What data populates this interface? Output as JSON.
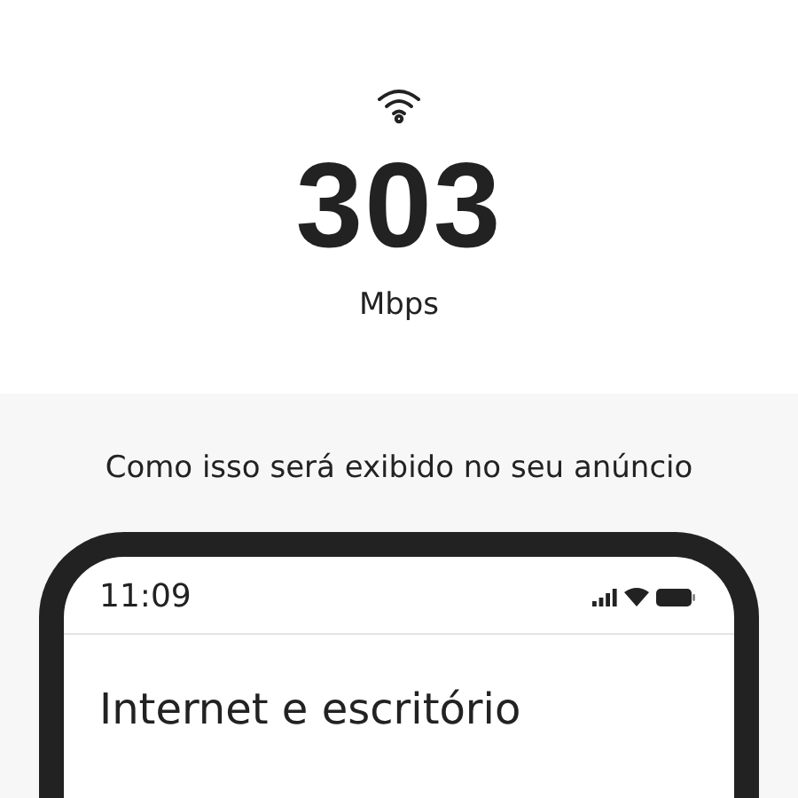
{
  "speed": {
    "value": "303",
    "unit": "Mbps"
  },
  "caption": "Como isso será exibido no seu anúncio",
  "phone": {
    "status_bar": {
      "time": "11:09"
    },
    "title": "Internet e escritório"
  }
}
